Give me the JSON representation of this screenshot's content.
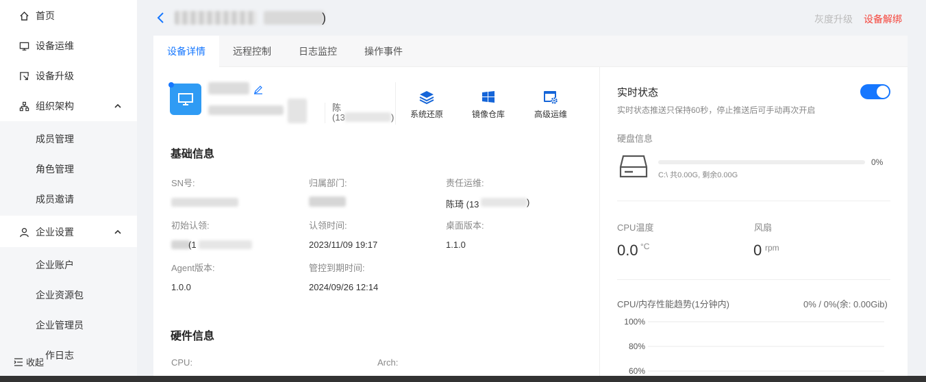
{
  "sidebar": {
    "items": [
      {
        "label": "首页",
        "icon": "home-icon"
      },
      {
        "label": "设备运维",
        "icon": "monitor-icon"
      },
      {
        "label": "设备升级",
        "icon": "upgrade-icon"
      },
      {
        "label": "组织架构",
        "icon": "org-icon",
        "expanded": true
      },
      {
        "label": "企业设置",
        "icon": "user-icon",
        "expanded": true
      }
    ],
    "org_sub": [
      "成员管理",
      "角色管理",
      "成员邀请"
    ],
    "company_sub": [
      "企业账户",
      "企业资源包",
      "企业管理员",
      "作日志"
    ],
    "collapse_label": "收起"
  },
  "header": {
    "title_suffix": ")",
    "gray_upgrade": "灰度升级",
    "unbind": "设备解绑"
  },
  "tabs": [
    "设备详情",
    "远程控制",
    "日志监控",
    "操作事件"
  ],
  "device": {
    "owner_prefix": "陈",
    "owner_phone_prefix": "(13",
    "owner_phone_suffix": ")"
  },
  "actions": [
    {
      "label": "系统还原",
      "icon": "layers-icon"
    },
    {
      "label": "镜像仓库",
      "icon": "windows-icon"
    },
    {
      "label": "高级运维",
      "icon": "gear-window-icon"
    }
  ],
  "basic": {
    "title": "基础信息",
    "sn_label": "SN号:",
    "dept_label": "归属部门:",
    "ops_label": "责任运维:",
    "ops_value_prefix": "陈琦 (13",
    "ops_value_suffix": ")",
    "claim_label": "初始认领:",
    "claim_value_prefix": "(1",
    "claim_time_label": "认领时间:",
    "claim_time_value": "2023/11/09 19:17",
    "desktop_label": "桌面版本:",
    "desktop_value": "1.1.0",
    "agent_label": "Agent版本:",
    "agent_value": "1.0.0",
    "expire_label": "管控到期时间:",
    "expire_value": "2024/09/26 12:14"
  },
  "hardware": {
    "title": "硬件信息",
    "cpu_label": "CPU:",
    "arch_label": "Arch:"
  },
  "realtime": {
    "title": "实时状态",
    "subtitle": "实时状态推送只保持60秒，停止推送后可手动再次开启",
    "toggle_on": true,
    "disk_label": "硬盘信息",
    "disk_pct": "0%",
    "disk_usage_fraction": 0,
    "disk_info": "C:\\ 共0.00G, 剩余0.00G",
    "cpu_temp_label": "CPU温度",
    "cpu_temp_value": "0.0",
    "cpu_temp_unit": "°C",
    "fan_label": "风扇",
    "fan_value": "0",
    "fan_unit": "rpm",
    "trend_label": "CPU/内存性能趋势(1分钟内)",
    "trend_value": "0% / 0%(余: 0.00Gib)",
    "y_ticks": [
      "100%",
      "80%",
      "60%"
    ]
  },
  "colors": {
    "accent": "#1677ff",
    "danger": "#f5443a",
    "device_icon": "#2f9bf4"
  }
}
